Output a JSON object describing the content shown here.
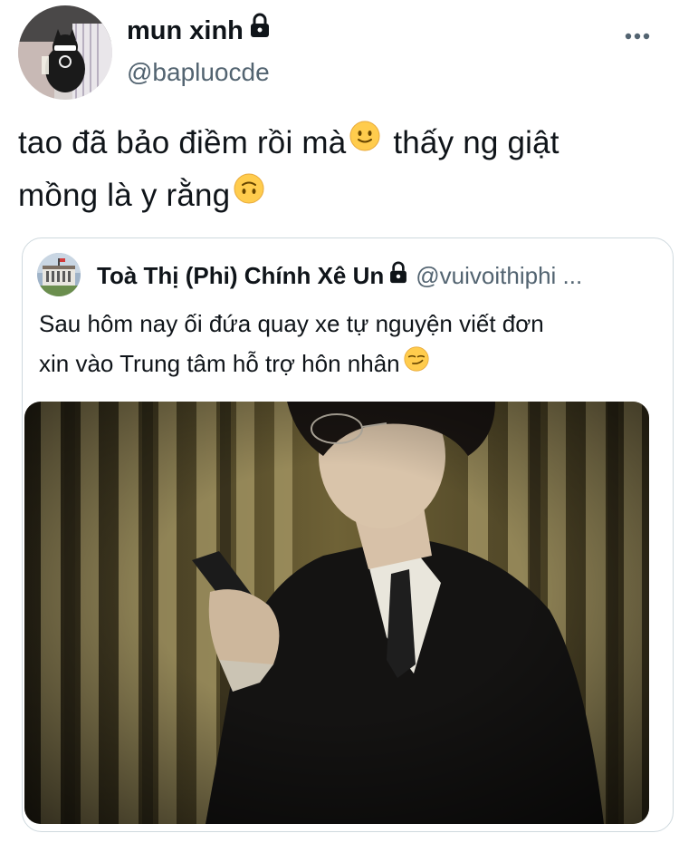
{
  "tweet": {
    "author_name": "mun xinh",
    "author_handle": "@bapluocde",
    "text_line1": "tao đã bảo điềm rồi mà",
    "text_line1b": "thấy ng giật",
    "text_line2": "mồng là y rằng",
    "emoji1": "slightly-smiling-face",
    "emoji2": "upside-down-face",
    "protected": true
  },
  "quote": {
    "author_name": "Toà Thị (Phi) Chính Xê Un",
    "author_handle": "@vuivoithiphi ...",
    "text_line1": "Sau hôm nay ối đứa quay xe tự nguyện viết đơn",
    "text_line2": "xin vào Trung tâm hỗ trợ hôn nhân",
    "emoji": "smirking-face",
    "protected": true,
    "media_description": "photo"
  },
  "colors": {
    "text": "#0f1419",
    "secondary": "#536471",
    "border": "#cfd9de"
  }
}
